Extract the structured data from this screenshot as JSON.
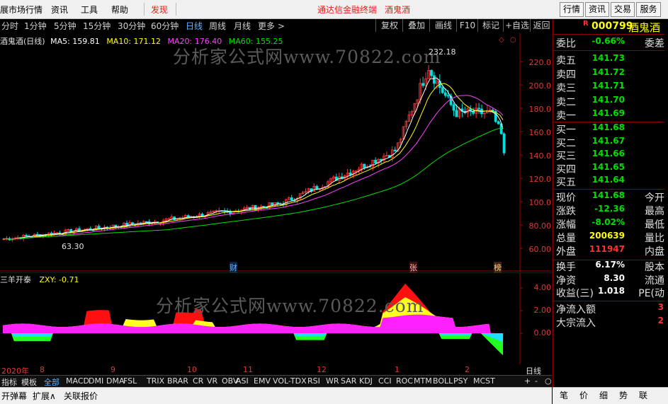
{
  "menubar": {
    "items": [
      "展市场行情",
      "资讯",
      "工具",
      "帮助"
    ],
    "discover": "发现",
    "center_title": "通达信金融终端",
    "stock_name_title": "酒鬼酒",
    "right_buttons": [
      "行情",
      "资讯",
      "交易",
      "服务"
    ]
  },
  "periods": [
    "分时",
    "1分钟",
    "5分钟",
    "15分钟",
    "30分钟",
    "60分钟",
    "日线",
    "周线",
    "月线",
    "更多 >"
  ],
  "active_period": "日线",
  "tools": [
    "复权",
    "叠加",
    "画线",
    "F10",
    "标记",
    "+自选",
    "返回"
  ],
  "main_legend": {
    "name": "酒鬼酒(日线)",
    "ma5": "MA5: 159.81",
    "ma10": "MA10: 171.12",
    "ma20": "MA20: 176.40",
    "ma60": "MA60: 155.25"
  },
  "watermark": "分析家公式网www.70822.com",
  "price_axis": [
    "220.0",
    "200.0",
    "180.0",
    "160.0",
    "140.0",
    "120.0",
    "100.0",
    "80.00",
    "60.00"
  ],
  "indicator_axis": [
    "4.00",
    "2.00",
    "0.00"
  ],
  "high_label": "232.18",
  "low_label": "63.30",
  "markers": [
    "财",
    "张",
    "榜"
  ],
  "indicator_legend": {
    "name": "三羊开泰",
    "value": "ZXY: -0.71"
  },
  "x_axis": [
    "2020年",
    "8",
    "9",
    "10",
    "11",
    "12",
    "1",
    "2"
  ],
  "x_axis_right": "日线",
  "indicator_tabs": [
    "指标",
    "模板",
    "全部",
    "MACD",
    "DMI",
    "DMA",
    "FSL",
    "TRIX",
    "BRAR",
    "CR",
    "VR",
    "OBV",
    "ASI",
    "EMV",
    "VOL-TDX",
    "RSI",
    "WR",
    "SAR",
    "KDJ",
    "CCI",
    "ROC",
    "MTM",
    "BOLL",
    "PSY",
    "MCST"
  ],
  "tab_controls": [
    "+",
    "-",
    "○"
  ],
  "bottom_buttons": [
    "开弹幕",
    "扩展∧",
    "关联报价"
  ],
  "quote": {
    "r_mark": "R",
    "code": "000799",
    "name": "酒鬼酒",
    "weibi_label": "委比",
    "weibi_value": "-0.66%",
    "weicha_label": "委差",
    "asks": [
      {
        "label": "卖五",
        "price": "141.73"
      },
      {
        "label": "卖四",
        "price": "141.72"
      },
      {
        "label": "卖三",
        "price": "141.71"
      },
      {
        "label": "卖二",
        "price": "141.70"
      },
      {
        "label": "卖一",
        "price": "141.69"
      }
    ],
    "bids": [
      {
        "label": "买一",
        "price": "141.68"
      },
      {
        "label": "买二",
        "price": "141.67"
      },
      {
        "label": "买三",
        "price": "141.66"
      },
      {
        "label": "买四",
        "price": "141.65"
      },
      {
        "label": "买五",
        "price": "141.64"
      }
    ],
    "stats": [
      {
        "label": "现价",
        "value": "141.68",
        "label2": "今开",
        "cls": "dn"
      },
      {
        "label": "涨跌",
        "value": "-12.36",
        "label2": "最高",
        "cls": "dn"
      },
      {
        "label": "涨幅",
        "value": "-8.02%",
        "label2": "最低",
        "cls": "dn"
      },
      {
        "label": "总量",
        "value": "200639",
        "label2": "量比",
        "cls": "yel"
      },
      {
        "label": "外盘",
        "value": "111947",
        "label2": "内盘",
        "cls": "up"
      }
    ],
    "stats2": [
      {
        "label": "换手",
        "value": "6.17%",
        "label2": "股本",
        "cls": "wht"
      },
      {
        "label": "净资",
        "value": "8.30",
        "label2": "流通",
        "cls": "wht"
      },
      {
        "label": "收益(三)",
        "value": "1.018",
        "label2": "PE(动",
        "cls": "wht"
      }
    ],
    "flows": [
      {
        "label": "净流入额",
        "value": "3"
      },
      {
        "label": "大宗流入",
        "value": "2"
      }
    ]
  },
  "right_tabs": [
    "笔",
    "价",
    "细",
    "势",
    "联"
  ],
  "colors": {
    "up": "#ff3232",
    "down": "#00e000",
    "ma5": "#ffffff",
    "ma10": "#ffff00",
    "ma20": "#ff40ff",
    "ma60": "#00e000"
  }
}
